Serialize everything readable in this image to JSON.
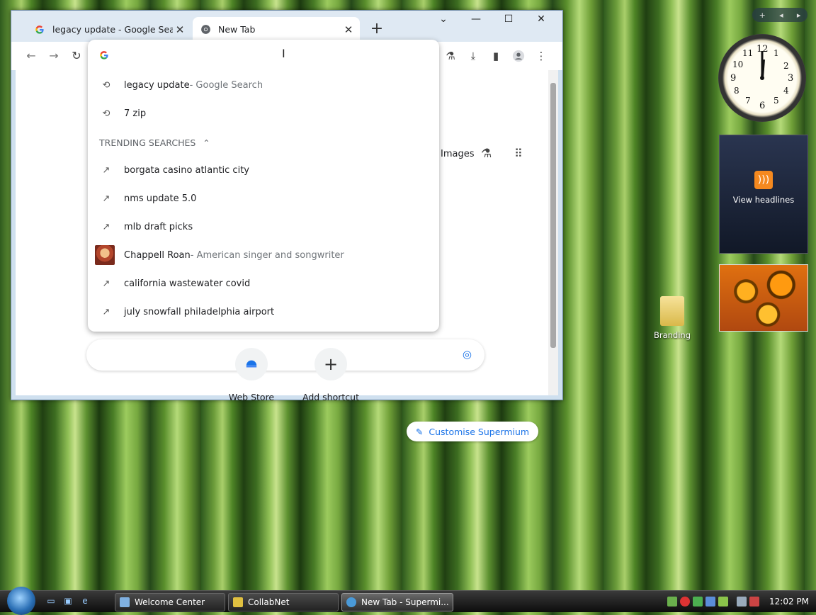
{
  "browser": {
    "tabs": [
      {
        "title": "legacy update - Google Search",
        "close": "✕"
      },
      {
        "title": "New Tab",
        "close": "✕"
      }
    ],
    "new_tab_symbol": "+",
    "window_controls": {
      "dropdown": "⌄",
      "minimize": "—",
      "maximize": "☐",
      "close": "✕"
    },
    "omnibox": {
      "value": "",
      "caret": "I"
    },
    "suggestions_recent": [
      {
        "icon": "history-icon",
        "text": "legacy update",
        "sub": " - Google Search"
      },
      {
        "icon": "history-icon",
        "text": "7 zip",
        "sub": ""
      }
    ],
    "trending_header": "TRENDING SEARCHES",
    "trending": [
      {
        "icon": "trending-icon",
        "text": "borgata casino atlantic city",
        "sub": ""
      },
      {
        "icon": "trending-icon",
        "text": "nms update 5.0",
        "sub": ""
      },
      {
        "icon": "trending-icon",
        "text": "mlb draft picks",
        "sub": ""
      },
      {
        "icon": "entity-image",
        "text": "Chappell Roan",
        "sub": " - American singer and songwriter"
      },
      {
        "icon": "trending-icon",
        "text": "california wastewater covid",
        "sub": ""
      },
      {
        "icon": "trending-icon",
        "text": "july snowfall philadelphia airport",
        "sub": ""
      }
    ],
    "page": {
      "images_link": "Images",
      "shortcuts": [
        {
          "label": "Web Store"
        },
        {
          "label": "Add shortcut",
          "symbol": "+"
        }
      ],
      "customise_label": "Customise Supermium"
    }
  },
  "desktop": {
    "gadgets": {
      "headlines_label": "View headlines",
      "clock_numbers": [
        "12",
        "1",
        "2",
        "3",
        "4",
        "5",
        "6",
        "7",
        "8",
        "9",
        "10",
        "11"
      ]
    },
    "icons": [
      {
        "label": "Branding"
      }
    ]
  },
  "taskbar": {
    "buttons": [
      {
        "label": "Welcome Center",
        "color": "#7fb0e0"
      },
      {
        "label": "CollabNet",
        "color": "#e0c040"
      },
      {
        "label": "New Tab - Supermi...",
        "color": "#4a9ad8",
        "active": true
      }
    ],
    "clock": "12:02 PM"
  },
  "colors": {
    "accent": "#1a73e8",
    "taskbar": "#1a1a1a"
  }
}
